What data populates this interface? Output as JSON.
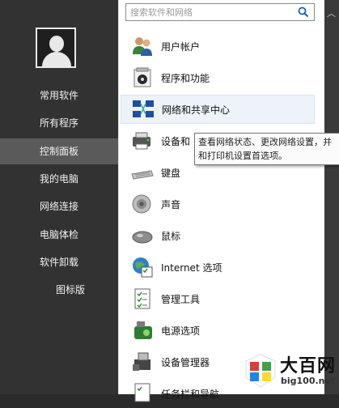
{
  "search": {
    "placeholder": "搜索软件和网络"
  },
  "sidebar": {
    "items": [
      {
        "label": "常用软件"
      },
      {
        "label": "所有程序"
      },
      {
        "label": "控制面板",
        "active": true
      },
      {
        "label": "我的电脑"
      },
      {
        "label": "网络连接"
      },
      {
        "label": "电脑体检"
      },
      {
        "label": "软件卸载"
      },
      {
        "label": "图标版"
      }
    ]
  },
  "panel": {
    "items": [
      {
        "label": "用户帐户",
        "icon": "user-accounts-icon"
      },
      {
        "label": "程序和功能",
        "icon": "programs-features-icon"
      },
      {
        "label": "网络和共享中心",
        "icon": "network-sharing-icon"
      },
      {
        "label": "设备和",
        "icon": "devices-printers-icon"
      },
      {
        "label": "键盘",
        "icon": "keyboard-icon"
      },
      {
        "label": "声音",
        "icon": "sound-icon"
      },
      {
        "label": "鼠标",
        "icon": "mouse-icon"
      },
      {
        "label": "Internet 选项",
        "icon": "internet-options-icon"
      },
      {
        "label": "管理工具",
        "icon": "admin-tools-icon"
      },
      {
        "label": "电源选项",
        "icon": "power-options-icon"
      },
      {
        "label": "设备管理器",
        "icon": "device-manager-icon"
      },
      {
        "label": "任务栏和导航",
        "icon": "taskbar-icon"
      }
    ]
  },
  "tooltip": {
    "text": "查看网络状态、更改网络设置，并和打印机设置首选项。"
  },
  "watermark": {
    "title": "大百网",
    "url": "big100.net"
  },
  "colors": {
    "sidebar": "#323232",
    "active": "#5a5a5a",
    "panel": "#ffffff",
    "accent": "#1a5fb4"
  }
}
